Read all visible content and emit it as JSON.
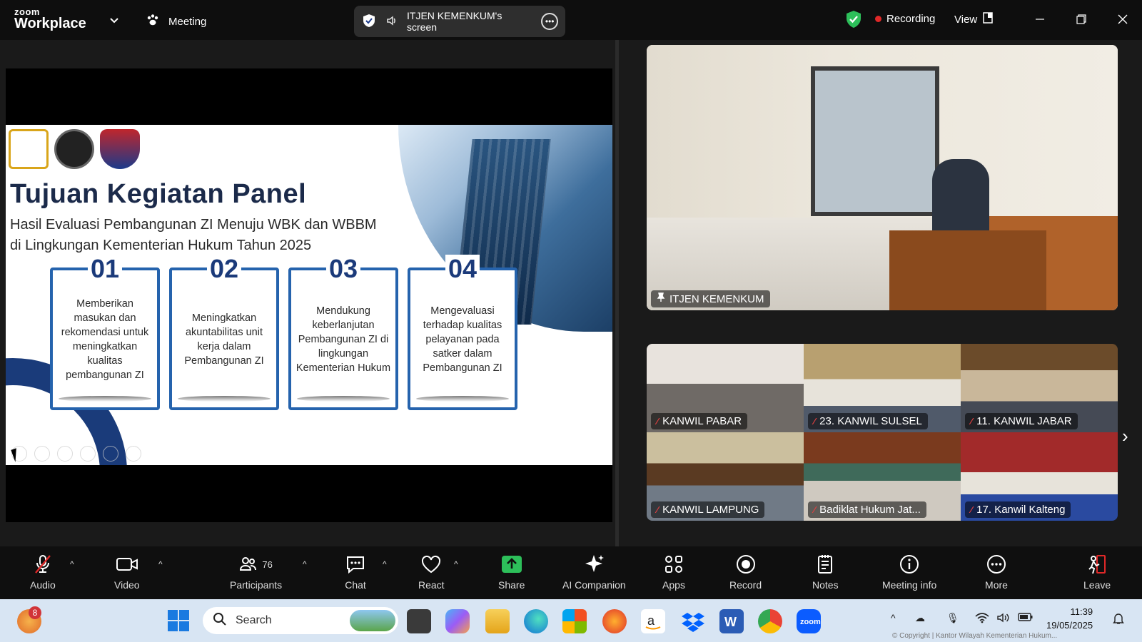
{
  "app": {
    "brand_top": "zoom",
    "brand_bottom": "Workplace",
    "meeting_label": "Meeting"
  },
  "share_pill": {
    "label": "ITJEN KEMENKUM's screen"
  },
  "status": {
    "recording": "Recording",
    "view": "View"
  },
  "slide": {
    "title": "Tujuan Kegiatan Panel",
    "subtitle_line1": "Hasil Evaluasi Pembangunan ZI Menuju WBK dan WBBM",
    "subtitle_line2": "di Lingkungan Kementerian Hukum Tahun 2025",
    "cards": [
      {
        "num": "01",
        "text": "Memberikan masukan dan rekomendasi untuk meningkatkan kualitas pembangunan ZI"
      },
      {
        "num": "02",
        "text": "Meningkatkan akuntabilitas unit kerja dalam Pembangunan ZI"
      },
      {
        "num": "03",
        "text": "Mendukung keberlanjutan Pembangunan ZI di lingkungan Kementerian Hukum"
      },
      {
        "num": "04",
        "text": "Mengevaluasi terhadap kualitas pelayanan pada satker dalam Pembangunan ZI"
      }
    ]
  },
  "speaker": {
    "name": "ITJEN KEMENKUM"
  },
  "gallery": [
    {
      "name": "KANWIL PABAR"
    },
    {
      "name": "23. KANWIL SULSEL"
    },
    {
      "name": "11. KANWIL JABAR"
    },
    {
      "name": "KANWIL LAMPUNG"
    },
    {
      "name": "Badiklat Hukum Jat..."
    },
    {
      "name": "17. Kanwil Kalteng"
    }
  ],
  "toolbar": {
    "audio": "Audio",
    "video": "Video",
    "participants": "Participants",
    "participants_count": "76",
    "chat": "Chat",
    "react": "React",
    "share": "Share",
    "ai_companion": "AI Companion",
    "apps": "Apps",
    "record": "Record",
    "notes": "Notes",
    "meeting_info": "Meeting info",
    "more": "More",
    "leave": "Leave"
  },
  "taskbar": {
    "search_placeholder": "Search",
    "notification_count": "8",
    "time": "11:39",
    "date": "19/05/2025",
    "copyright": "© Copyright | Kantor Wilayah Kementerian Hukum..."
  },
  "colors": {
    "accent_green": "#2dbf5a",
    "record_red": "#e02828",
    "slide_blue": "#2563ad"
  }
}
